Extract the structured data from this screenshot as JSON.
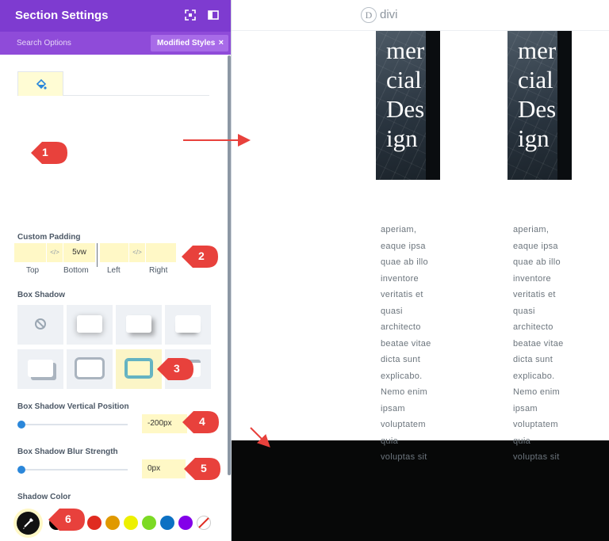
{
  "panel": {
    "title": "Section Settings",
    "search_options": "Search Options",
    "modified_styles": "Modified Styles",
    "close_glyph": "×",
    "accent": "#7e3bd0"
  },
  "padding": {
    "label": "Custom Padding",
    "link_glyph": "</>",
    "top_value": "",
    "bottom_value": "5vw",
    "left_value": "",
    "right_value": "",
    "labels": [
      "Top",
      "Bottom",
      "Left",
      "Right"
    ]
  },
  "box_shadow": {
    "label": "Box Shadow",
    "selected_index": 6
  },
  "vertical": {
    "label": "Box Shadow Vertical Position",
    "value": "-200px",
    "level": 0
  },
  "blur": {
    "label": "Box Shadow Blur Strength",
    "value": "0px",
    "level": 0
  },
  "shadow_color": {
    "label": "Shadow Color",
    "swatches": [
      "#000000",
      "#e02b20",
      "#e09900",
      "#edf000",
      "#7cda24",
      "#0c71c3",
      "#8300e9"
    ]
  },
  "annotations": [
    "1",
    "2",
    "3",
    "4",
    "5",
    "6"
  ],
  "preview": {
    "logo_letter": "D",
    "logo_text": "divi",
    "image_text": [
      "mer",
      "cial",
      "Des",
      "ign"
    ],
    "body_lines": [
      "aperiam,",
      "eaque ipsa",
      "quae ab illo",
      "inventore",
      "veritatis et",
      "quasi",
      "architecto",
      "beatae vitae",
      "dicta sunt",
      "explicabo.",
      "Nemo enim",
      "ipsam",
      "voluptatem",
      "quia",
      "voluptas sit"
    ],
    "footer_color": "#070808"
  }
}
